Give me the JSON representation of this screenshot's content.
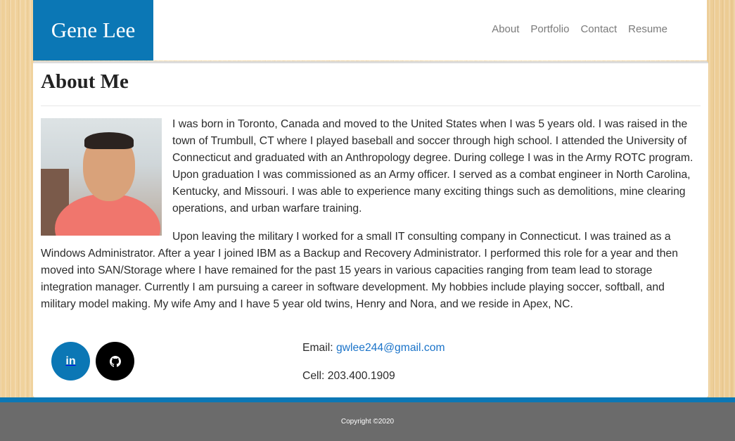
{
  "header": {
    "brand": "Gene Lee",
    "nav": [
      "About",
      "Portfolio",
      "Contact",
      "Resume"
    ]
  },
  "about": {
    "title": "About Me",
    "paragraphs": [
      "I was born in Toronto, Canada and moved to the United States when I was 5 years old. I was raised in the town of Trumbull, CT where I played baseball and soccer through high school. I attended the University of Connecticut and graduated with an Anthropology degree. During college I was in the Army ROTC program. Upon graduation I was commissioned as an Army officer. I served as a combat engineer in North Carolina, Kentucky, and Missouri. I was able to experience many exciting things such as demolitions, mine clearing operations, and urban warfare training.",
      "Upon leaving the military I worked for a small IT consulting company in Connecticut. I was trained as a Windows Administrator. After a year I joined IBM as a Backup and Recovery Administrator. I performed this role for a year and then moved into SAN/Storage where I have remained for the past 15 years in various capacities ranging from team lead to storage integration manager. Currently I am pursuing a career in software development. My hobbies include playing soccer, softball, and military model making. My wife Amy and I have 5 year old twins, Henry and Nora, and we reside in Apex, NC."
    ]
  },
  "social": {
    "linkedin_text": "in",
    "icons": [
      "linkedin-icon",
      "github-icon"
    ]
  },
  "contact": {
    "email_label": "Email: ",
    "email": "gwlee244@gmail.com",
    "cell_label": "Cell: ",
    "cell": "203.400.1909"
  },
  "footer": {
    "copyright": "Copyright ©2020"
  },
  "colors": {
    "brand_blue": "#0b77b5",
    "footer_gray": "#6b6b6b",
    "link_blue": "#1a73c9"
  }
}
